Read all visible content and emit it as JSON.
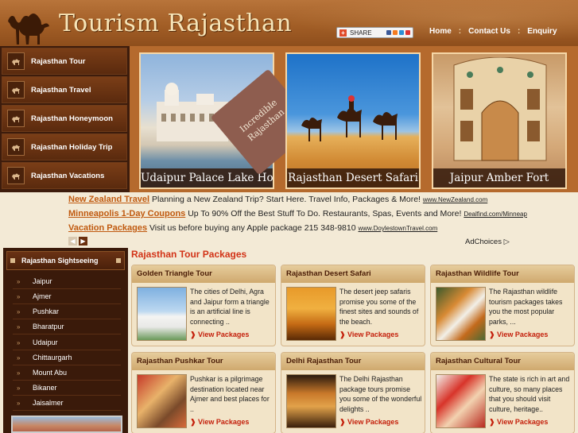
{
  "header": {
    "title": "Tourism Rajasthan",
    "share_label": "SHARE",
    "nav": [
      "Home",
      "Contact Us",
      "Enquiry"
    ],
    "nav_sep": ":"
  },
  "left_menu": [
    "Rajasthan Tour",
    "Rajasthan Travel",
    "Rajasthan Honeymoon",
    "Rajasthan Holiday Trip",
    "Rajasthan Vacations"
  ],
  "banner": {
    "photos": [
      "Udaipur Palace Lake Hotel",
      "Rajasthan Desert Safari",
      "Jaipur Amber Fort"
    ],
    "tag_line1": "Incredible",
    "tag_line2": "Rajasthan"
  },
  "ads": [
    {
      "title": "New Zealand Travel",
      "text": "Planning a New Zealand Trip? Start Here. Travel Info, Packages & More!",
      "url": "www.NewZealand.com"
    },
    {
      "title": "Minneapolis 1-Day Coupons",
      "text": "Up To 90% Off the Best Stuff To Do. Restaurants, Spas, Events and More!",
      "url": "Dealfind.com/Minneap"
    },
    {
      "title": "Vacation Packages",
      "text": "Visit us before buying any Apple package 215 348-9810",
      "url": "www.DoylestownTravel.com"
    }
  ],
  "adchoices": "AdChoices",
  "sightseeing": {
    "title": "Rajasthan Sightseeing",
    "items": [
      "Jaipur",
      "Ajmer",
      "Pushkar",
      "Bharatpur",
      "Udaipur",
      "Chittaurgarh",
      "Mount Abu",
      "Bikaner",
      "Jaisalmer"
    ]
  },
  "packages": {
    "title": "Rajasthan Tour Packages",
    "link_label": "View Packages",
    "cards": [
      {
        "title": "Golden Triangle Tour",
        "desc": "The cities of Delhi, Agra and Jaipur form a triangle is an artificial line is connecting .."
      },
      {
        "title": "Rajasthan Desert Safari",
        "desc": "The desert jeep safaris promise you some of the finest sites and sounds of the beach."
      },
      {
        "title": "Rajasthan Wildlife Tour",
        "desc": "The Rajasthan wildlife tourism packages takes you the most popular parks, ..."
      },
      {
        "title": "Rajasthan Pushkar Tour",
        "desc": "Pushkar is a pilgrimage destination located near Ajmer and best places for .."
      },
      {
        "title": "Delhi Rajasthan Tour",
        "desc": "The Delhi Rajasthan package tours promise you some of the wonderful delights .."
      },
      {
        "title": "Rajasthan Cultural Tour",
        "desc": "The state is rich in art and culture, so many places that you should visit culture, heritage.."
      }
    ]
  }
}
